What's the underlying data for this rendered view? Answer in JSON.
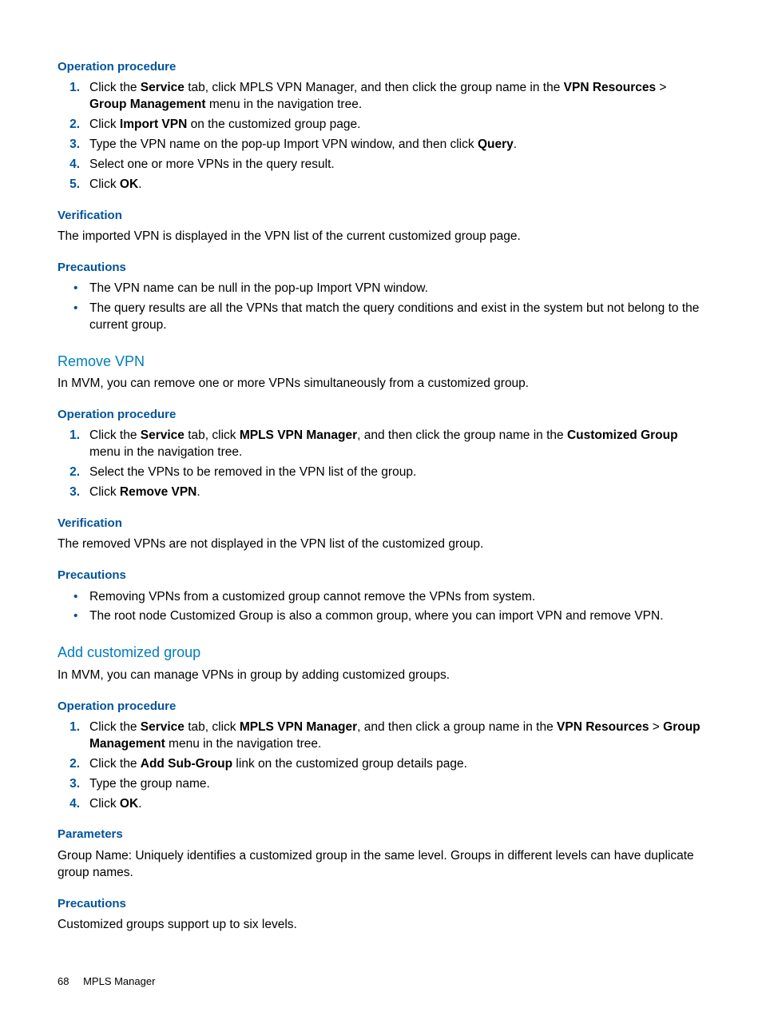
{
  "section1": {
    "opproc_heading": "Operation procedure",
    "steps": [
      {
        "pre": "Click the ",
        "b1": "Service",
        "mid1": " tab, click MPLS VPN Manager, and then click the group name in the ",
        "b2": "VPN Resources",
        "mid2": " > ",
        "b3": "Group Management",
        "post": " menu in the navigation tree."
      },
      {
        "pre": "Click ",
        "b1": "Import VPN",
        "post": " on the customized group page."
      },
      {
        "pre": "Type the VPN name on the pop-up Import VPN window, and then click ",
        "b1": "Query",
        "post": "."
      },
      {
        "pre": "Select one or more VPNs in the query result.",
        "plain": true
      },
      {
        "pre": "Click ",
        "b1": "OK",
        "post": "."
      }
    ],
    "verif_heading": "Verification",
    "verif_text": "The imported VPN is displayed in the VPN list of the current customized group page.",
    "prec_heading": "Precautions",
    "prec_bullets": [
      "The VPN name can be null in the pop-up Import VPN window.",
      "The query results are all the VPNs that match the query conditions and exist in the system but not belong to the current group."
    ]
  },
  "section2": {
    "title": "Remove VPN",
    "intro": "In MVM, you can remove one or more VPNs simultaneously from a customized group.",
    "opproc_heading": "Operation procedure",
    "steps": [
      {
        "pre": "Click the ",
        "b1": "Service",
        "mid1": " tab, click ",
        "b2": "MPLS VPN Manager",
        "mid2": ", and then click the group name in the ",
        "b3": "Customized Group",
        "post": " menu in the navigation tree."
      },
      {
        "pre": "Select the VPNs to be removed in the VPN list of the group.",
        "plain": true
      },
      {
        "pre": "Click ",
        "b1": "Remove VPN",
        "post": "."
      }
    ],
    "verif_heading": "Verification",
    "verif_text": "The removed VPNs are not displayed in the VPN list of the customized group.",
    "prec_heading": "Precautions",
    "prec_bullets": [
      "Removing VPNs from a customized group cannot remove the VPNs from system.",
      "The root node Customized Group is also a common group, where you can import VPN and remove VPN."
    ]
  },
  "section3": {
    "title": "Add customized group",
    "intro": "In MVM, you can manage VPNs in group by adding customized groups.",
    "opproc_heading": "Operation procedure",
    "steps": [
      {
        "pre": "Click the ",
        "b1": "Service",
        "mid1": " tab, click ",
        "b2": "MPLS VPN Manager",
        "mid2": ", and then click a group name in the ",
        "b3": "VPN Resources",
        "mid3": " > ",
        "b4": "Group Management",
        "post": " menu in the navigation tree."
      },
      {
        "pre": "Click the ",
        "b1": "Add Sub-Group",
        "post": " link on the customized group details page."
      },
      {
        "pre": "Type the group name.",
        "plain": true
      },
      {
        "pre": "Click ",
        "b1": "OK",
        "post": "."
      }
    ],
    "param_heading": "Parameters",
    "param_text": "Group Name: Uniquely identifies a customized group in the same level. Groups in different levels can have duplicate group names.",
    "prec_heading": "Precautions",
    "prec_text": "Customized groups support up to six levels."
  },
  "footer": {
    "page": "68",
    "title": "MPLS Manager"
  }
}
